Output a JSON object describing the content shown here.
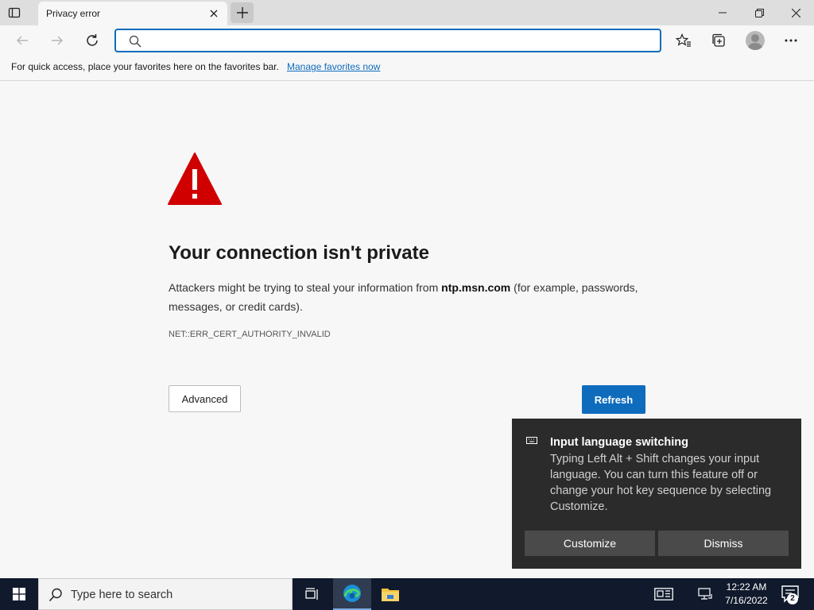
{
  "browser": {
    "tab": {
      "title": "Privacy error"
    },
    "addressbar": {
      "value": "",
      "placeholder": ""
    }
  },
  "favorites_bar": {
    "text": "For quick access, place your favorites here on the favorites bar.",
    "link": "Manage favorites now"
  },
  "error_page": {
    "heading": "Your connection isn't private",
    "desc_prefix": "Attackers might be trying to steal your information from ",
    "domain": "ntp.msn.com",
    "desc_suffix": " (for example, passwords, messages, or credit cards).",
    "error_code": "NET::ERR_CERT_AUTHORITY_INVALID",
    "advanced_label": "Advanced",
    "refresh_label": "Refresh",
    "warning_color": "#d00000",
    "accent_color": "#0f6cbd"
  },
  "toast": {
    "title": "Input language switching",
    "body": "Typing Left Alt + Shift changes your input language. You can turn this feature off or change your hot key sequence by selecting Customize.",
    "customize_label": "Customize",
    "dismiss_label": "Dismiss"
  },
  "taskbar": {
    "search_placeholder": "Type here to search",
    "time": "12:22 AM",
    "date": "7/16/2022",
    "notification_count": "2"
  }
}
